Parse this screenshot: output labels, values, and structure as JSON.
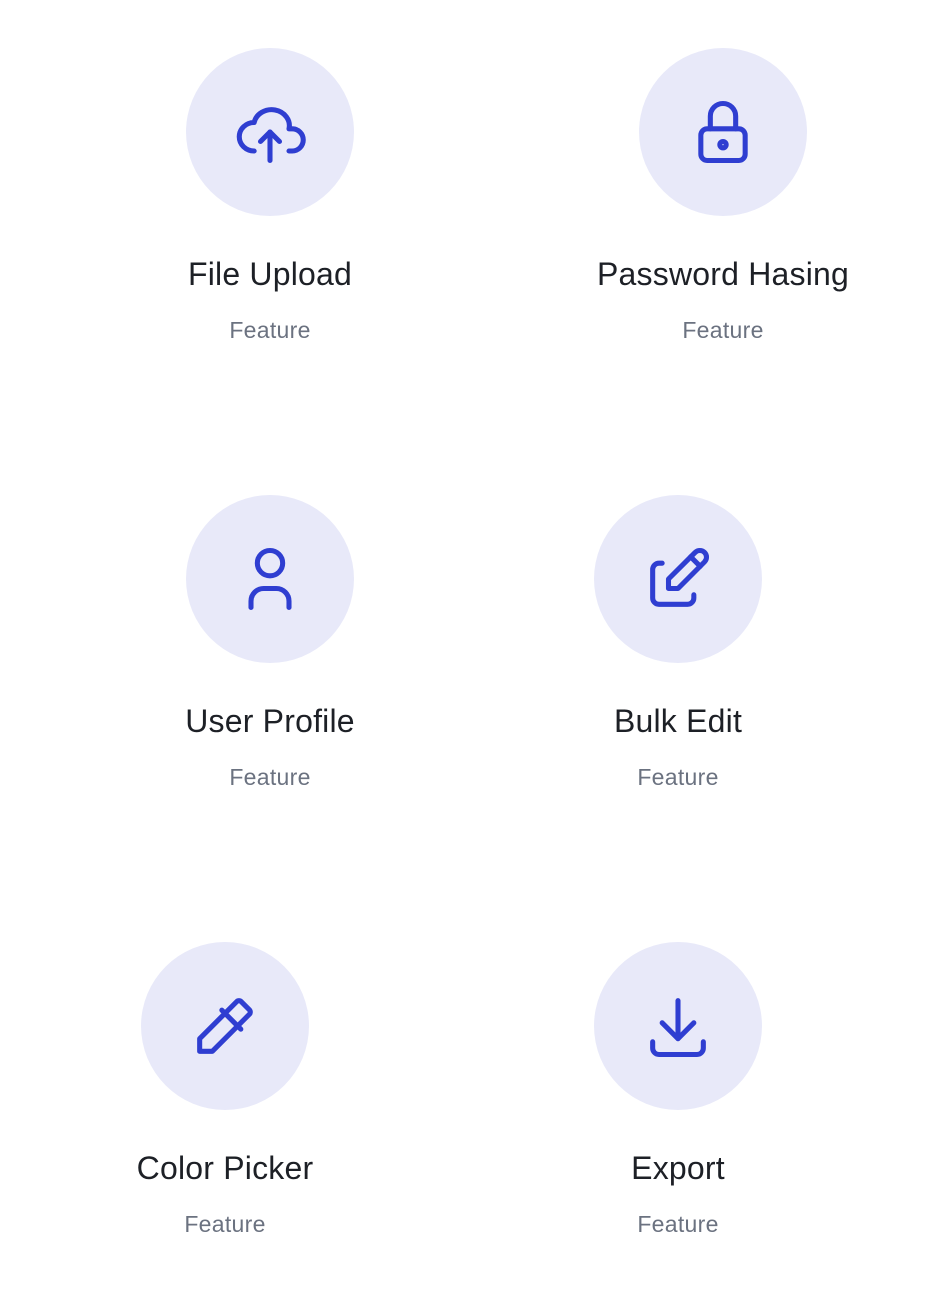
{
  "colors": {
    "accent": "#2F3ED1",
    "circle_bg": "#E8E9F9",
    "title": "#1D2026",
    "subtitle": "#6B7280"
  },
  "features": [
    {
      "title": "File Upload",
      "subtitle": "Feature",
      "icon": "cloud-upload-icon"
    },
    {
      "title": "Password Hasing",
      "subtitle": "Feature",
      "icon": "lock-icon"
    },
    {
      "title": "User Profile",
      "subtitle": "Feature",
      "icon": "user-icon"
    },
    {
      "title": "Bulk Edit",
      "subtitle": "Feature",
      "icon": "edit-icon"
    },
    {
      "title": "Color Picker",
      "subtitle": "Feature",
      "icon": "eyedropper-icon"
    },
    {
      "title": "Export",
      "subtitle": "Feature",
      "icon": "download-icon"
    }
  ]
}
